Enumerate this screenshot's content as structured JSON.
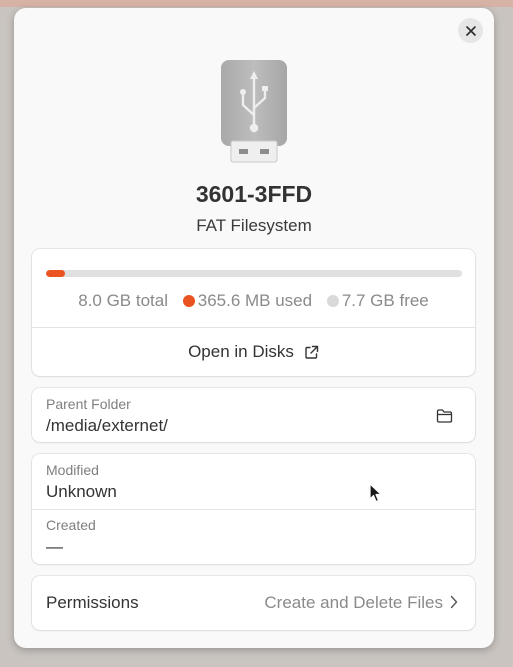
{
  "drive": {
    "name": "3601-3FFD",
    "filesystem": "FAT Filesystem",
    "icon": "usb-drive-icon"
  },
  "usage": {
    "total_label": "8.0 GB total",
    "used_label": "365.6 MB used",
    "free_label": "7.7 GB free",
    "used_fraction": 0.046,
    "used_color": "#e95420",
    "free_color": "#d9d9d9"
  },
  "actions": {
    "open_in_disks": "Open in Disks"
  },
  "parent_folder": {
    "label": "Parent Folder",
    "value": "/media/externet/"
  },
  "dates": {
    "modified_label": "Modified",
    "modified_value": "Unknown",
    "created_label": "Created",
    "created_value": "—"
  },
  "permissions": {
    "label": "Permissions",
    "value": "Create and Delete Files"
  },
  "icons": {
    "close": "close-icon",
    "external_link": "external-link-icon",
    "folder": "folder-icon",
    "chevron": "chevron-right-icon"
  },
  "colors": {
    "accent": "#e95420",
    "dialog_bg": "#f9f9f9",
    "card_bg": "#ffffff"
  }
}
